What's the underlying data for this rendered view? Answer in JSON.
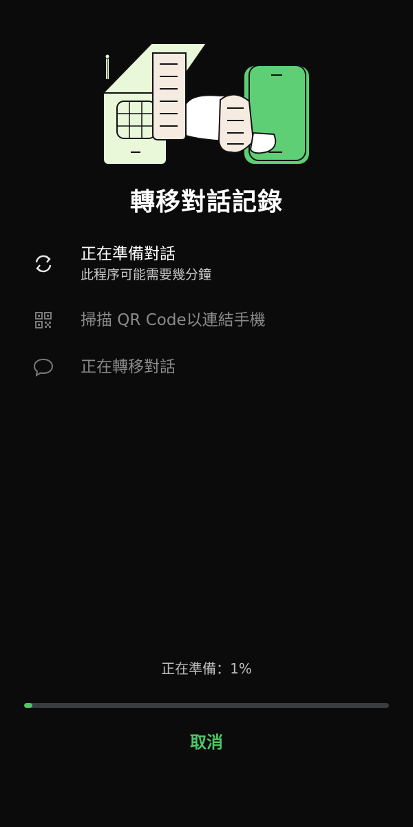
{
  "title": "轉移對話記錄",
  "steps": [
    {
      "label": "正在準備對話",
      "sub": "此程序可能需要幾分鐘",
      "icon": "sync-icon",
      "state": "active"
    },
    {
      "label": "掃描 QR Code以連結手機",
      "icon": "qr-code-icon",
      "state": "pending"
    },
    {
      "label": "正在轉移對話",
      "icon": "chat-bubble-icon",
      "state": "pending"
    }
  ],
  "progress": {
    "text": "正在準備：1%",
    "fraction": 0.01
  },
  "cancel_label": "取消",
  "colors": {
    "accent": "#4cc764",
    "background": "#0b0b0b",
    "track": "#3b3c40"
  }
}
